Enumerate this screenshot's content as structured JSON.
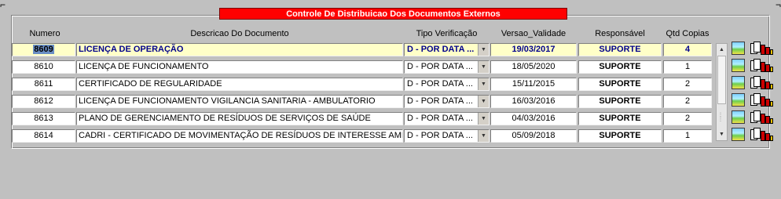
{
  "window": {
    "corner_left": "⌐",
    "corner_right": "¬"
  },
  "panel": {
    "title": "Controle De Distribuicao Dos Documentos Externos"
  },
  "columns": {
    "numero": "Numero",
    "descricao": "Descricao Do Documento",
    "tipo": "Tipo Verificação",
    "versao": "Versao_Validade",
    "responsavel": "Responsável",
    "qtd": "Qtd Copias"
  },
  "rows": [
    {
      "numero": "8609",
      "descricao": "LICENÇA DE OPERAÇÃO",
      "tipo": "D - POR DATA ...",
      "versao": "19/03/2017",
      "responsavel": "SUPORTE",
      "qtd": "4",
      "selected": true
    },
    {
      "numero": "8610",
      "descricao": "LICENÇA DE FUNCIONAMENTO",
      "tipo": "D - POR DATA ...",
      "versao": "18/05/2020",
      "responsavel": "SUPORTE",
      "qtd": "1"
    },
    {
      "numero": "8611",
      "descricao": "CERTIFICADO DE REGULARIDADE",
      "tipo": "D - POR DATA ...",
      "versao": "15/11/2015",
      "responsavel": "SUPORTE",
      "qtd": "2"
    },
    {
      "numero": "8612",
      "descricao": "LICENÇA DE FUNCIONAMENTO VIGILANCIA SANITARIA - AMBULATORIO",
      "tipo": "D - POR DATA ...",
      "versao": "16/03/2016",
      "responsavel": "SUPORTE",
      "qtd": "2"
    },
    {
      "numero": "8613",
      "descricao": "PLANO DE GERENCIAMENTO DE RESÍDUOS DE SERVIÇOS DE SAÚDE",
      "tipo": "D - POR DATA ...",
      "versao": "04/03/2016",
      "responsavel": "SUPORTE",
      "qtd": "2"
    },
    {
      "numero": "8614",
      "descricao": "CADRI - CERTIFICADO DE MOVIMENTAÇÃO DE RESÍDUOS DE INTERESSE AMBIENTAL",
      "tipo": "D - POR DATA ...",
      "versao": "05/09/2018",
      "responsavel": "SUPORTE",
      "qtd": "1"
    }
  ],
  "icons": {
    "combo": "dropdown-arrow-icon",
    "row_image": "image-icon",
    "row_report": "report-chart-icon",
    "scroll_up": "scroll-up-arrow-icon",
    "scroll_down": "scroll-down-arrow-icon"
  },
  "colors": {
    "title_bar": "#ff0000",
    "selected_row": "#ffffc8",
    "selected_text": "#00008b",
    "background": "#c0c0c0"
  }
}
